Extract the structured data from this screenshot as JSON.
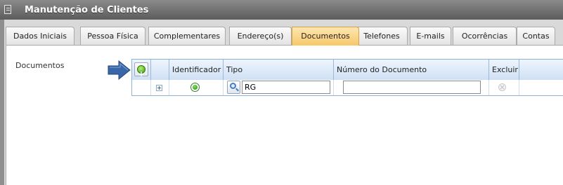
{
  "window": {
    "title": "Manutenção de Clientes",
    "icon": "document-icon"
  },
  "tabs": [
    {
      "label": "Dados Iniciais",
      "active": false
    },
    {
      "label": "Pessoa Física",
      "active": false
    },
    {
      "label": "Complementares",
      "active": false
    },
    {
      "label": "Endereço(s)",
      "active": false
    },
    {
      "label": "Documentos",
      "active": true
    },
    {
      "label": "Telefones",
      "active": false
    },
    {
      "label": "E-mails",
      "active": false
    },
    {
      "label": "Ocorrências",
      "active": false
    },
    {
      "label": "Contas",
      "active": false
    }
  ],
  "section": {
    "label": "Documentos"
  },
  "grid": {
    "columns": {
      "identificador": "Identificador",
      "tipo": "Tipo",
      "numero": "Número do Documento",
      "excluir": "Excluir"
    },
    "rows": [
      {
        "identificador_selected": true,
        "tipo": "RG",
        "numero": ""
      }
    ]
  },
  "colors": {
    "active_tab": "#f6c76a",
    "grid_header": "#cfe0f4",
    "arrow": "#3a67a8",
    "titlebar": "#6e6e6e"
  }
}
